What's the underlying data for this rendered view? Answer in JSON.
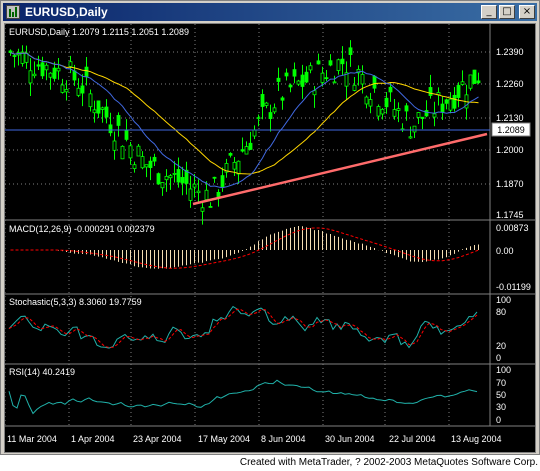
{
  "window": {
    "title": "EURUSD,Daily"
  },
  "main": {
    "header": "EURUSD,Daily  1.2079 1.2115 1.2051 1.2089",
    "price_label": "1.2089",
    "price_ticks": [
      "1.2390",
      "1.2260",
      "1.2130",
      "1.2000",
      "1.1870",
      "1.1745"
    ]
  },
  "macd": {
    "header": "MACD(12,26,9)  -0.000291  0.002379",
    "ticks": [
      "0.00873",
      "0.00",
      "-0.01199"
    ]
  },
  "stochastic": {
    "header": "Stochastic(5,3,3)  8.3060  19.7759",
    "ticks": [
      "100",
      "80",
      "20",
      "0"
    ]
  },
  "rsi": {
    "header": "RSI(14)  40.2419",
    "ticks": [
      "100",
      "70",
      "50",
      "30",
      "0"
    ]
  },
  "dates": [
    "11 Mar 2004",
    "1 Apr 2004",
    "23 Apr 2004",
    "17 May 2004",
    "8 Jun 2004",
    "30 Jun 2004",
    "22 Jul 2004",
    "13 Aug 2004"
  ],
  "footer": "Created with MetaTrader, ? 2002-2003 MetaQuotes Software Corp.",
  "colors": {
    "background": "#000000",
    "candle": "#00ff00",
    "grid": "#808080",
    "ma_slow": "#ffd700",
    "ma_fast": "#4169e1",
    "trendline": "#ff6b6b",
    "macd_hist": "#f5deb3",
    "signal": "#ff0000",
    "indicator": "#20b2aa"
  },
  "chart_data": {
    "type": "line",
    "title": "EURUSD,Daily",
    "x": [
      "11 Mar 2004",
      "1 Apr 2004",
      "23 Apr 2004",
      "17 May 2004",
      "8 Jun 2004",
      "30 Jun 2004",
      "22 Jul 2004",
      "13 Aug 2004"
    ],
    "series": [
      {
        "values": [
          1.236,
          1.226,
          1.195,
          1.182,
          1.22,
          1.233,
          1.209,
          1.228
        ]
      }
    ],
    "ylim": [
      1.1745,
      1.245
    ]
  }
}
